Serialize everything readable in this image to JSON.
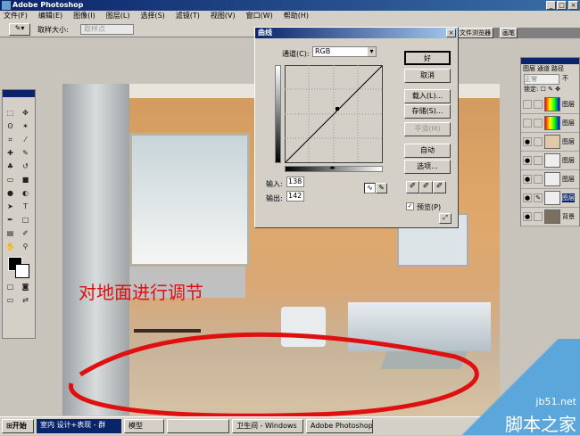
{
  "app": {
    "title": "Adobe Photoshop"
  },
  "menu": [
    "文件(F)",
    "编辑(E)",
    "图像(I)",
    "图层(L)",
    "选择(S)",
    "滤镜(T)",
    "视图(V)",
    "窗口(W)",
    "帮助(H)"
  ],
  "options": {
    "sample_label": "取样大小:",
    "sample_value": "取样点"
  },
  "palette_tabs": [
    "文件浏览器",
    "画笔"
  ],
  "annotation": "对地面进行调节",
  "curves": {
    "title": "曲线",
    "channel_label": "通道(C):",
    "channel_value": "RGB",
    "input_label": "输入:",
    "input_value": "138",
    "output_label": "输出:",
    "output_value": "142",
    "buttons": {
      "ok": "好",
      "cancel": "取消",
      "load": "载入(L)...",
      "save": "存储(S)...",
      "smooth": "平滑(M)",
      "auto": "自动",
      "options": "选项..."
    },
    "preview_label": "预览(P)",
    "preview_checked": true
  },
  "layers": {
    "tabs": [
      "图层",
      "通道",
      "路径"
    ],
    "blend": "正常",
    "opacity_prefix": "不",
    "lock_label": "锁定:",
    "items": [
      {
        "name": "图层",
        "visible": false
      },
      {
        "name": "图层",
        "visible": false
      },
      {
        "name": "图层",
        "visible": true
      },
      {
        "name": "图层",
        "visible": true
      },
      {
        "name": "图层",
        "visible": true
      },
      {
        "name": "图层",
        "visible": true,
        "selected": true
      },
      {
        "name": "背景",
        "visible": true
      }
    ]
  },
  "taskbar": {
    "start": "开始",
    "tasks": [
      "室内 设计+表现 - 群",
      "模型",
      "",
      "卫生间 - Windows",
      "Adobe Photoshop"
    ]
  },
  "watermark": {
    "site": "jb51.net",
    "name": "脚本之家"
  }
}
